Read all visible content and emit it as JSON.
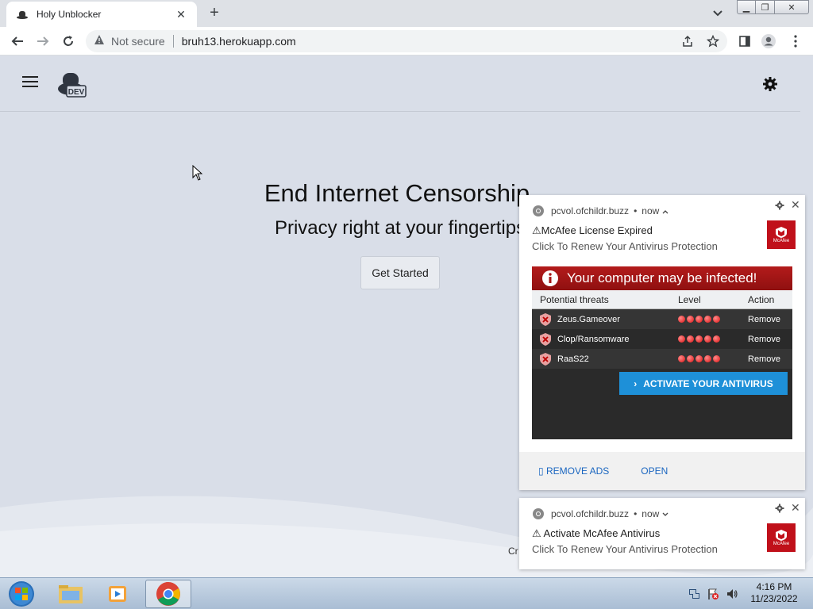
{
  "browser": {
    "tab_title": "Holy Unblocker",
    "security_label": "Not secure",
    "url": "bruh13.herokuapp.com"
  },
  "page": {
    "headline": "End Internet Censorship",
    "subheadline": "Privacy right at your fingertips",
    "cta_label": "Get Started",
    "footer_fragment": "Cr",
    "logo_text": "DEV"
  },
  "notifications": [
    {
      "source": "pcvol.ofchildr.buzz",
      "time": "now",
      "title": "⚠McAfee License Expired",
      "body": "Click To Renew Your Antivirus Protection",
      "brand_label": "McAfee",
      "image": {
        "banner": "Your computer may be infected!",
        "columns": [
          "Potential threats",
          "Level",
          "Action"
        ],
        "threats": [
          {
            "name": "Zeus.Gameover",
            "action": "Remove"
          },
          {
            "name": "Clop/Ransomware",
            "action": "Remove"
          },
          {
            "name": "RaaS22",
            "action": "Remove"
          }
        ],
        "button": "ACTIVATE YOUR ANTIVIRUS"
      },
      "actions": [
        "▯ REMOVE ADS",
        "OPEN"
      ]
    },
    {
      "source": "pcvol.ofchildr.buzz",
      "time": "now",
      "title": "⚠ Activate McAfee Antivirus",
      "body": "Click To Renew Your Antivirus Protection",
      "brand_label": "McAfee"
    }
  ],
  "taskbar": {
    "time": "4:16 PM",
    "date": "11/23/2022"
  },
  "colors": {
    "page_bg": "#d9dee8",
    "alert_red": "#b31b1b",
    "activate_blue": "#1e90d8",
    "mcafee_red": "#c0101a"
  }
}
